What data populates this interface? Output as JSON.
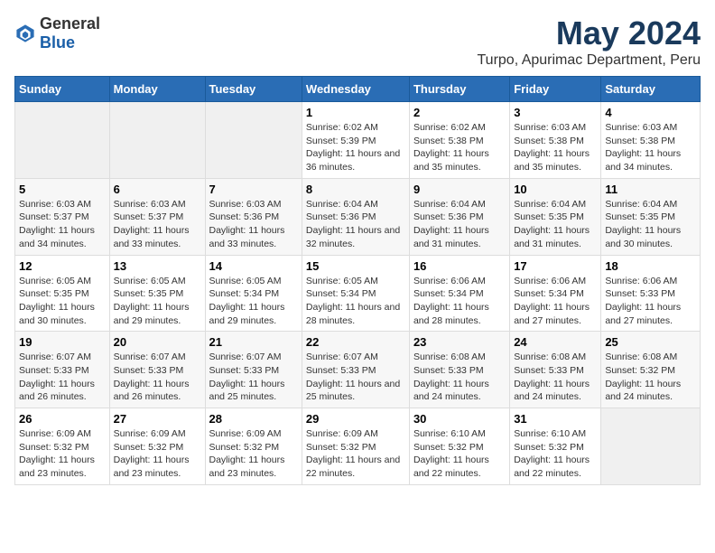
{
  "logo": {
    "text_general": "General",
    "text_blue": "Blue"
  },
  "title": "May 2024",
  "subtitle": "Turpo, Apurimac Department, Peru",
  "days_of_week": [
    "Sunday",
    "Monday",
    "Tuesday",
    "Wednesday",
    "Thursday",
    "Friday",
    "Saturday"
  ],
  "weeks": [
    {
      "days": [
        {
          "num": "",
          "info": "",
          "empty": true
        },
        {
          "num": "",
          "info": "",
          "empty": true
        },
        {
          "num": "",
          "info": "",
          "empty": true
        },
        {
          "num": "1",
          "info": "Sunrise: 6:02 AM\nSunset: 5:39 PM\nDaylight: 11 hours and 36 minutes."
        },
        {
          "num": "2",
          "info": "Sunrise: 6:02 AM\nSunset: 5:38 PM\nDaylight: 11 hours and 35 minutes."
        },
        {
          "num": "3",
          "info": "Sunrise: 6:03 AM\nSunset: 5:38 PM\nDaylight: 11 hours and 35 minutes."
        },
        {
          "num": "4",
          "info": "Sunrise: 6:03 AM\nSunset: 5:38 PM\nDaylight: 11 hours and 34 minutes."
        }
      ]
    },
    {
      "days": [
        {
          "num": "5",
          "info": "Sunrise: 6:03 AM\nSunset: 5:37 PM\nDaylight: 11 hours and 34 minutes."
        },
        {
          "num": "6",
          "info": "Sunrise: 6:03 AM\nSunset: 5:37 PM\nDaylight: 11 hours and 33 minutes."
        },
        {
          "num": "7",
          "info": "Sunrise: 6:03 AM\nSunset: 5:36 PM\nDaylight: 11 hours and 33 minutes."
        },
        {
          "num": "8",
          "info": "Sunrise: 6:04 AM\nSunset: 5:36 PM\nDaylight: 11 hours and 32 minutes."
        },
        {
          "num": "9",
          "info": "Sunrise: 6:04 AM\nSunset: 5:36 PM\nDaylight: 11 hours and 31 minutes."
        },
        {
          "num": "10",
          "info": "Sunrise: 6:04 AM\nSunset: 5:35 PM\nDaylight: 11 hours and 31 minutes."
        },
        {
          "num": "11",
          "info": "Sunrise: 6:04 AM\nSunset: 5:35 PM\nDaylight: 11 hours and 30 minutes."
        }
      ]
    },
    {
      "days": [
        {
          "num": "12",
          "info": "Sunrise: 6:05 AM\nSunset: 5:35 PM\nDaylight: 11 hours and 30 minutes."
        },
        {
          "num": "13",
          "info": "Sunrise: 6:05 AM\nSunset: 5:35 PM\nDaylight: 11 hours and 29 minutes."
        },
        {
          "num": "14",
          "info": "Sunrise: 6:05 AM\nSunset: 5:34 PM\nDaylight: 11 hours and 29 minutes."
        },
        {
          "num": "15",
          "info": "Sunrise: 6:05 AM\nSunset: 5:34 PM\nDaylight: 11 hours and 28 minutes."
        },
        {
          "num": "16",
          "info": "Sunrise: 6:06 AM\nSunset: 5:34 PM\nDaylight: 11 hours and 28 minutes."
        },
        {
          "num": "17",
          "info": "Sunrise: 6:06 AM\nSunset: 5:34 PM\nDaylight: 11 hours and 27 minutes."
        },
        {
          "num": "18",
          "info": "Sunrise: 6:06 AM\nSunset: 5:33 PM\nDaylight: 11 hours and 27 minutes."
        }
      ]
    },
    {
      "days": [
        {
          "num": "19",
          "info": "Sunrise: 6:07 AM\nSunset: 5:33 PM\nDaylight: 11 hours and 26 minutes."
        },
        {
          "num": "20",
          "info": "Sunrise: 6:07 AM\nSunset: 5:33 PM\nDaylight: 11 hours and 26 minutes."
        },
        {
          "num": "21",
          "info": "Sunrise: 6:07 AM\nSunset: 5:33 PM\nDaylight: 11 hours and 25 minutes."
        },
        {
          "num": "22",
          "info": "Sunrise: 6:07 AM\nSunset: 5:33 PM\nDaylight: 11 hours and 25 minutes."
        },
        {
          "num": "23",
          "info": "Sunrise: 6:08 AM\nSunset: 5:33 PM\nDaylight: 11 hours and 24 minutes."
        },
        {
          "num": "24",
          "info": "Sunrise: 6:08 AM\nSunset: 5:33 PM\nDaylight: 11 hours and 24 minutes."
        },
        {
          "num": "25",
          "info": "Sunrise: 6:08 AM\nSunset: 5:32 PM\nDaylight: 11 hours and 24 minutes."
        }
      ]
    },
    {
      "days": [
        {
          "num": "26",
          "info": "Sunrise: 6:09 AM\nSunset: 5:32 PM\nDaylight: 11 hours and 23 minutes."
        },
        {
          "num": "27",
          "info": "Sunrise: 6:09 AM\nSunset: 5:32 PM\nDaylight: 11 hours and 23 minutes."
        },
        {
          "num": "28",
          "info": "Sunrise: 6:09 AM\nSunset: 5:32 PM\nDaylight: 11 hours and 23 minutes."
        },
        {
          "num": "29",
          "info": "Sunrise: 6:09 AM\nSunset: 5:32 PM\nDaylight: 11 hours and 22 minutes."
        },
        {
          "num": "30",
          "info": "Sunrise: 6:10 AM\nSunset: 5:32 PM\nDaylight: 11 hours and 22 minutes."
        },
        {
          "num": "31",
          "info": "Sunrise: 6:10 AM\nSunset: 5:32 PM\nDaylight: 11 hours and 22 minutes."
        },
        {
          "num": "",
          "info": "",
          "empty": true
        }
      ]
    }
  ]
}
